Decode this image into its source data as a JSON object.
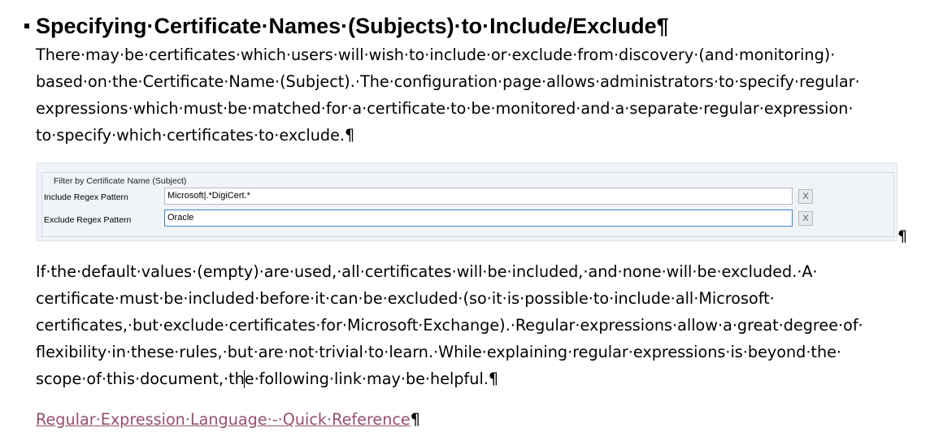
{
  "heading": "Specifying·Certificate·Names·(Subjects)·to·Include/Exclude¶",
  "paragraph1": [
    "There·may·be·certificates·which·users·will·wish·to·include·or·exclude·from·discovery·(and·monitoring)·",
    "based·on·the·Certificate·Name·(Subject).·The·configuration·page·allows·administrators·to·specify·regular·",
    "expressions·which·must·be·matched·for·a·certificate·to·be·monitored·and·a·separate·regular·expression·",
    "to·specify·which·certificates·to·exclude.¶"
  ],
  "filter_panel": {
    "group_title": "Filter by Certificate Name (Subject)",
    "include_label": "Include Regex Pattern",
    "include_value": "Microsoft|.*DigiCert.*",
    "exclude_label": "Exclude Regex Pattern",
    "exclude_value": "Oracle",
    "clear_label": "X"
  },
  "panel_pilcrow": "¶",
  "paragraph2": [
    "If·the·default·values·(empty)·are·used,·all·certificates·will·be·included,·and·none·will·be·excluded.·A·",
    "certificate·must·be·included·before·it·can·be·excluded·(so·it·is·possible·to·include·all·Microsoft·",
    "certificates,·but·exclude·certificates·for·Microsoft·Exchange).·Regular·expressions·allow·a·great·degree·of·",
    "flexibility·in·these·rules,·but·are·not·trivial·to·learn.·While·explaining·regular·expressions·is·beyond·the·"
  ],
  "paragraph2_last": {
    "before_caret": "scope·of·this·document,·th",
    "after_caret": "e·following·link·may·be·helpful.¶"
  },
  "link": {
    "text": "Regular·Expression·Language·-·Quick·Reference",
    "pilcrow": "¶",
    "color": "#954f72"
  }
}
